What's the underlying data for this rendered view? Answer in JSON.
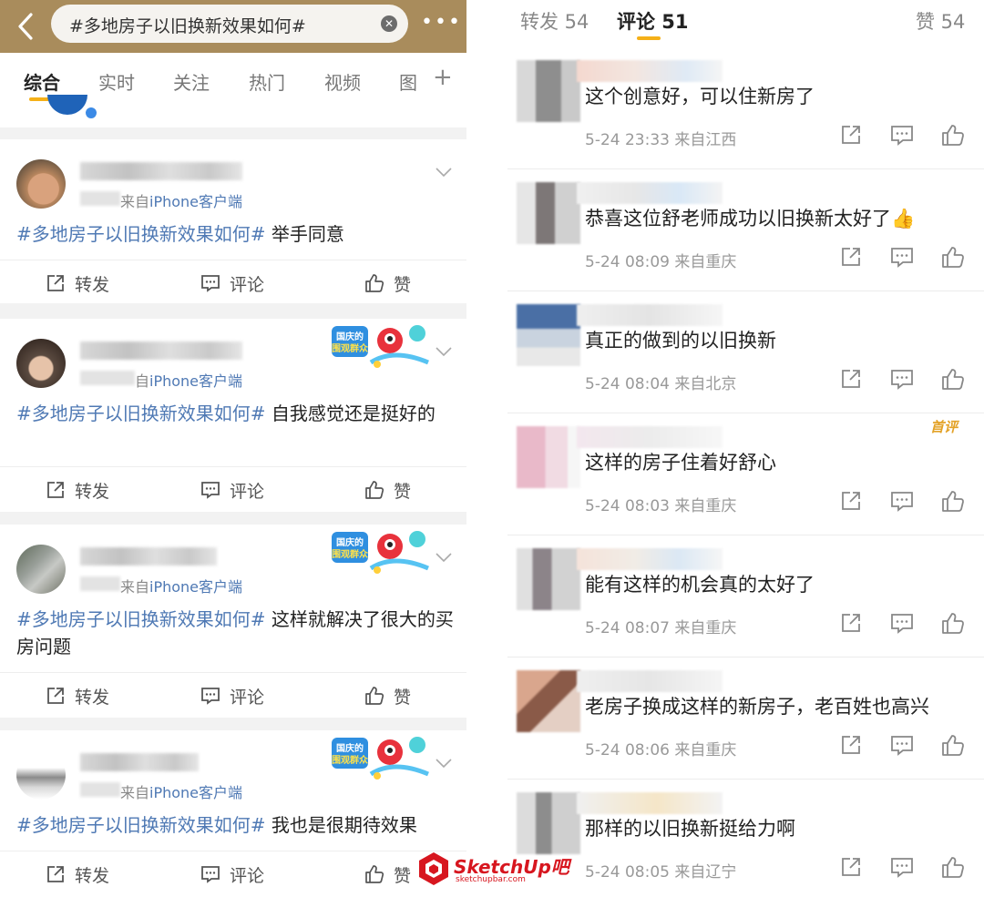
{
  "search": {
    "query": "#多地房子以旧换新效果如何#",
    "clear_icon": "close-circle-icon",
    "more_label": "•••"
  },
  "tabs": [
    {
      "label": "综合",
      "active": true
    },
    {
      "label": "实时",
      "active": false
    },
    {
      "label": "关注",
      "active": false
    },
    {
      "label": "热门",
      "active": false
    },
    {
      "label": "视频",
      "active": false
    },
    {
      "label": "图",
      "active": false
    }
  ],
  "tab_plus": "+",
  "posts": [
    {
      "source_prefix": "来自",
      "source_client": "iPhone客户端",
      "hashtag": "#多地房子以旧换新效果如何#",
      "text": " 举手同意",
      "repost": "转发",
      "comment": "评论",
      "like": "赞"
    },
    {
      "source_prefix": "自",
      "source_client": "iPhone客户端",
      "hashtag": "#多地房子以旧换新效果如何#",
      "text": " 自我感觉还是挺好的",
      "repost": "转发",
      "comment": "评论",
      "like": "赞"
    },
    {
      "source_prefix": "来自",
      "source_client": "iPhone客户端",
      "hashtag": "#多地房子以旧换新效果如何#",
      "text": " 这样就解决了很大的买房问题",
      "repost": "转发",
      "comment": "评论",
      "like": "赞"
    },
    {
      "source_prefix": "来自",
      "source_client": "iPhone客户端",
      "hashtag": "#多地房子以旧换新效果如何#",
      "text": " 我也是很期待效果",
      "repost": "转发",
      "comment": "评论",
      "like": "赞"
    }
  ],
  "badge_text": "国庆的图观群众",
  "right_tabs": {
    "repost": "转发 54",
    "comments": "评论 51",
    "likes": "赞 54"
  },
  "comments": [
    {
      "text": "这个创意好，可以住新房了",
      "meta": "5-24 23:33 来自江西"
    },
    {
      "text": "恭喜这位舒老师成功以旧换新太好了👍",
      "meta": "5-24 08:09 来自重庆"
    },
    {
      "text": "真正的做到的以旧换新",
      "meta": "5-24 08:04 来自北京"
    },
    {
      "text": "这样的房子住着好舒心",
      "meta": "5-24 08:03 来自重庆",
      "badge": "首评"
    },
    {
      "text": "能有这样的机会真的太好了",
      "meta": "5-24 08:07 来自重庆"
    },
    {
      "text": "老房子换成这样的新房子，老百姓也高兴",
      "meta": "5-24 08:06 来自重庆"
    },
    {
      "text": "那样的以旧换新挺给力啊",
      "meta": "5-24 08:05 来自辽宁"
    }
  ],
  "watermark": {
    "title": "SketchUp吧",
    "subtitle": "sketchupbar.com"
  },
  "colors": {
    "header_bg": "#a98c5c",
    "accent": "#f5b018",
    "link": "#4f79b4",
    "watermark": "#d7161f"
  }
}
